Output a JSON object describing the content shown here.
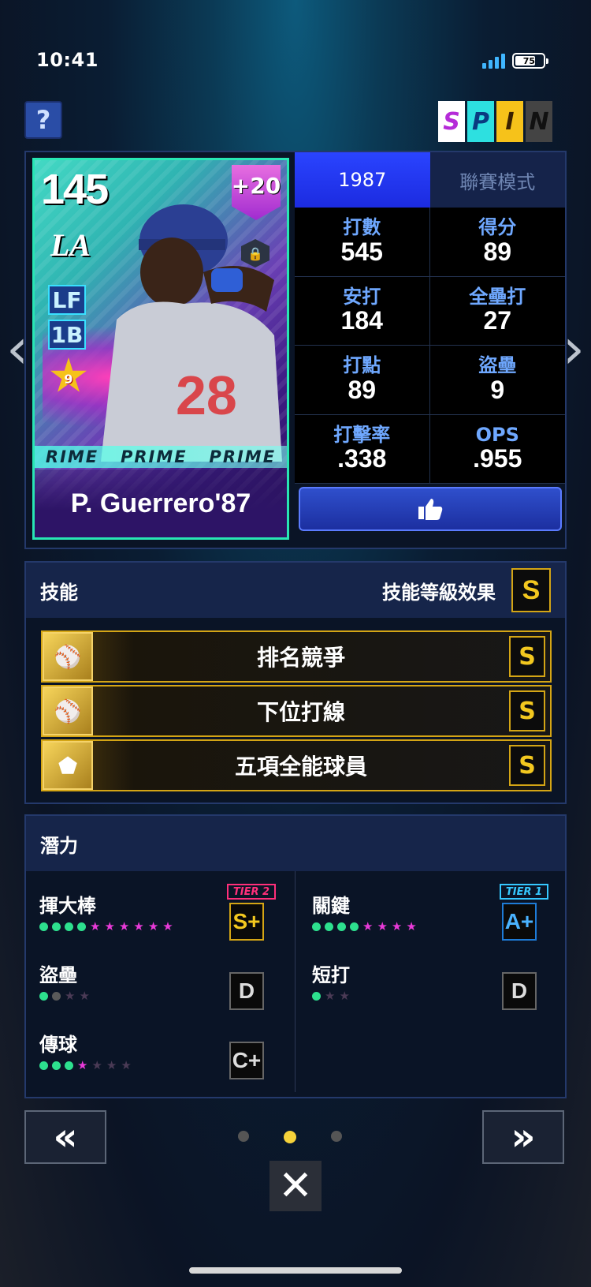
{
  "status_bar": {
    "time": "10:41",
    "battery": "75"
  },
  "header": {
    "help_label": "?",
    "spin_letters": [
      "S",
      "P",
      "I",
      "N"
    ]
  },
  "card": {
    "overall": "145",
    "team": "LA",
    "positions": [
      "LF",
      "1B"
    ],
    "boost": "+20",
    "star_level": "9",
    "prime_text": [
      "RIME",
      "PRIME",
      "PRIME"
    ],
    "player_name": "P. Guerrero'87",
    "jersey_number": "28"
  },
  "tabs": [
    {
      "label": "1987",
      "active": true
    },
    {
      "label": "聯賽模式",
      "active": false
    }
  ],
  "stats": [
    {
      "label": "打數",
      "value": "545"
    },
    {
      "label": "得分",
      "value": "89"
    },
    {
      "label": "安打",
      "value": "184"
    },
    {
      "label": "全壘打",
      "value": "27"
    },
    {
      "label": "打點",
      "value": "89"
    },
    {
      "label": "盜壘",
      "value": "9"
    },
    {
      "label": "打擊率",
      "value": ".338"
    },
    {
      "label": "OPS",
      "value": ".955"
    }
  ],
  "like_button": {
    "icon": "thumbs-up-icon"
  },
  "skills": {
    "title": "技能",
    "effect_label": "技能等級效果",
    "effect_grade": "S",
    "items": [
      {
        "name": "排名競爭",
        "grade": "S",
        "icon": "bat-chart-icon"
      },
      {
        "name": "下位打線",
        "grade": "S",
        "icon": "batter-lineup-icon"
      },
      {
        "name": "五項全能球員",
        "grade": "S",
        "icon": "pentagon-icon"
      }
    ]
  },
  "potential": {
    "title": "潛力",
    "items": [
      {
        "label": "揮大棒",
        "tier": "TIER 2",
        "grade": "S+",
        "green_dots": 4,
        "pink_stars": 6,
        "off_stars": 0
      },
      {
        "label": "關鍵",
        "tier": "TIER 1",
        "grade": "A+",
        "green_dots": 4,
        "pink_stars": 4,
        "off_stars": 0
      },
      {
        "label": "盜壘",
        "tier": "",
        "grade": "D",
        "green_dots": 1,
        "grey_dots": 1,
        "pink_stars": 0,
        "off_stars": 2
      },
      {
        "label": "短打",
        "tier": "",
        "grade": "D",
        "green_dots": 1,
        "pink_stars": 0,
        "off_stars": 2
      },
      {
        "label": "傳球",
        "tier": "",
        "grade": "C+",
        "green_dots": 3,
        "pink_stars": 1,
        "off_stars": 3
      }
    ]
  },
  "footer": {
    "prev_label": "«",
    "next_label": "»",
    "close_label": "✕",
    "page_count": 3,
    "active_page": 2
  }
}
